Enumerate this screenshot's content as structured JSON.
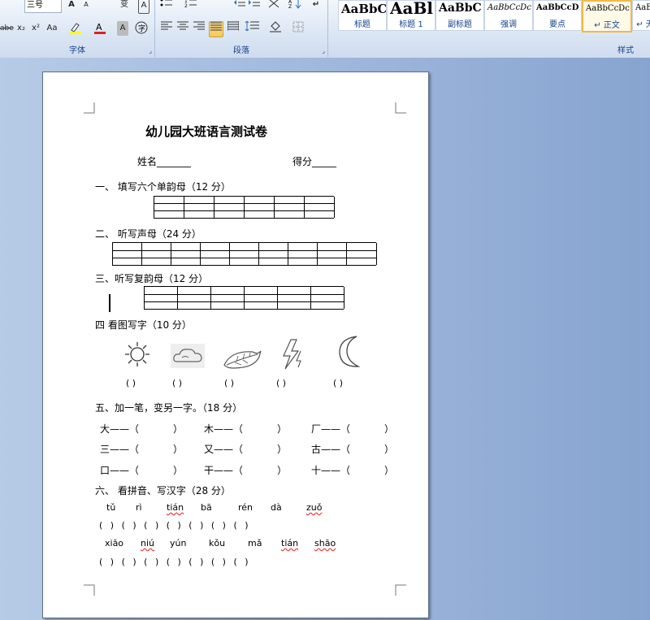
{
  "ribbon": {
    "font_group_label": "字体",
    "paragraph_group_label": "段落",
    "styles_group_label": "样式",
    "font_size": "三号",
    "font_buttons_row1": [
      "A",
      "A",
      "变",
      "A"
    ],
    "font_buttons_row2": [
      "abe",
      "x₂",
      "x²",
      "Aa"
    ],
    "styles": [
      {
        "sample": "AaBbC",
        "name": "标题"
      },
      {
        "sample": "AaBl",
        "name": "标题 1"
      },
      {
        "sample": "AaBbC",
        "name": "副标题"
      },
      {
        "sample": "AaBbCcDc",
        "name": "强调"
      },
      {
        "sample": "AaBbCcD",
        "name": "要点"
      },
      {
        "sample": "AaBbCcDc",
        "name": "↵ 正文"
      },
      {
        "sample": "AaBb",
        "name": "↵ 无"
      }
    ]
  },
  "doc": {
    "title": "幼儿园大班语言测试卷",
    "name_label": "姓名_______",
    "score_label": "得分_____",
    "q1": "一、 填写六个单韵母（12 分）",
    "q2": "二、 听写声母（24 分）",
    "q3": "三、听写复韵母（12 分）",
    "q4": "四  看图写字（10 分）",
    "q5": "五、加一笔，变另一字。（18 分）",
    "q6": "六、    看拼音、写汉字（28 分）",
    "paren_pair": "(      )",
    "q5_items": [
      [
        "大——（",
        "）",
        "木——（",
        "）",
        "厂——（",
        "）"
      ],
      [
        "三——（",
        "）",
        "又——（",
        "）",
        "古——（",
        "）"
      ],
      [
        "口——（",
        "）",
        "干——（",
        "）",
        "十——（",
        "）"
      ]
    ],
    "pinyin_row1": [
      "tǔ",
      "rì",
      "tián",
      "bā",
      "rén",
      "dà",
      "zuǒ"
    ],
    "pinyin_row2": [
      "xiāo",
      "niú",
      "yún",
      "kǒu",
      "mǎ",
      "tián",
      "shāo"
    ],
    "paren_row": "(   ) (   ) (   ) (   ) (   ) (   ) (   )"
  },
  "colors": {
    "ribbon_label": "#15428b",
    "spell_underline": "#e33",
    "active_style_border": "#f1b948"
  }
}
